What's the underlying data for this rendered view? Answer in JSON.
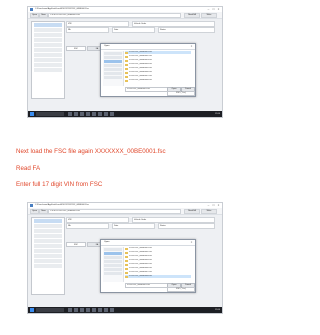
{
  "app": {
    "title": "C:\\Users\\user\\AppData\\Local\\FSC\\XXXXXXX_00BE0001.fsc",
    "path": "C:\\FSC\\XXXXXXX_00BE0001.fsc",
    "toolbar": {
      "open": "Open",
      "save": "Save",
      "read_fa": "Read FA",
      "write": "Write"
    },
    "fields": [
      "VIN",
      "Vehicle Order",
      "FA",
      "Date",
      "Status"
    ],
    "tabs": [
      "FSC",
      "FA",
      "VIN"
    ]
  },
  "dialog": {
    "title": "Open",
    "files": [
      "XXXXXXX_00BE0001.fsc",
      "XXXXXXX_00BE0002.fsc",
      "XXXXXXX_00BE0003.fsc",
      "XXXXXXX_00BE0004.fsc",
      "XXXXXXX_00BE0005.fsc",
      "XXXXXXX_00BE0006.fsc",
      "XXXXXXX_00BE0007.fsc",
      "XXXXXXX_00BE0008.fsc"
    ],
    "filename": "XXXXXXX_00BE0001.fsc",
    "filetype": "FSC (*.fsc)",
    "ok": "Open",
    "cancel": "Cancel"
  },
  "taskbar": {
    "clock": "12:00"
  },
  "instructions": {
    "line1": "Next load the FSC file again XXXXXXX_00BE0001.fsc",
    "line2": "Read FA",
    "line3": "Enter full 17 digit VIN from FSC"
  },
  "colors": {
    "instruction_text": "#e0472b",
    "taskbar": "#1d1f24",
    "selection": "#cde4fa"
  }
}
